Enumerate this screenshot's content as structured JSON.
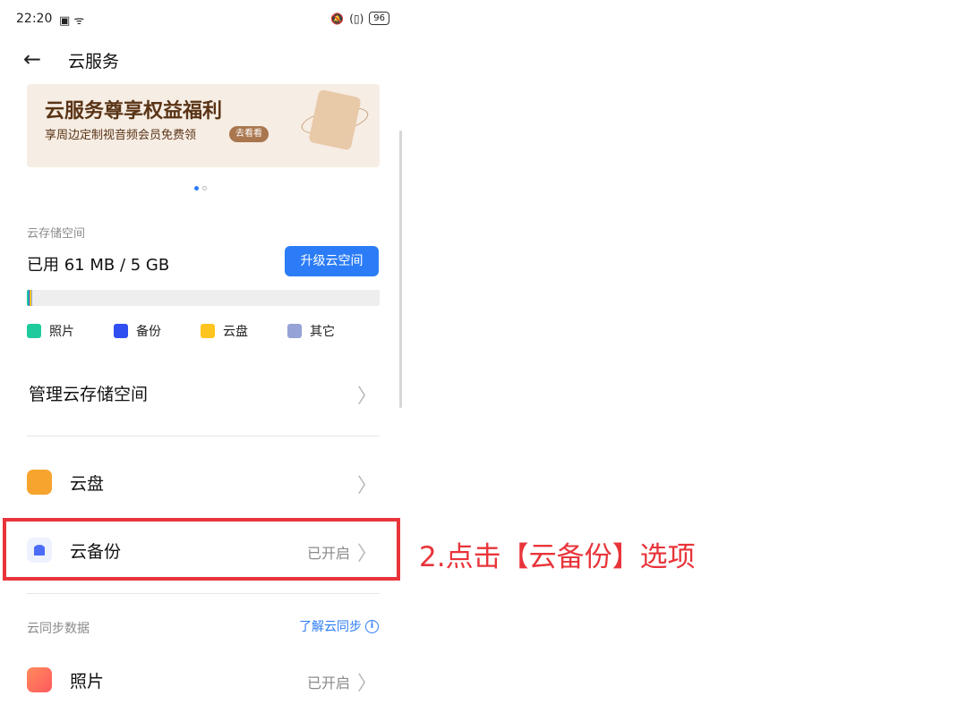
{
  "status_bar": {
    "time": "22:20",
    "battery": "96"
  },
  "nav": {
    "title": "云服务"
  },
  "banner": {
    "title": "云服务尊享权益福利",
    "subtitle": "享周边定制视音频会员免费领",
    "button": "去看看",
    "pages": 2,
    "active_page": 1
  },
  "storage": {
    "section_label": "云存储空间",
    "used_text": "已用 61 MB / 5 GB",
    "upgrade_button": "升级云空间",
    "legend": [
      {
        "label": "照片",
        "color": "#1fcb9c"
      },
      {
        "label": "备份",
        "color": "#2f4ff0"
      },
      {
        "label": "云盘",
        "color": "#ffc41f"
      },
      {
        "label": "其它",
        "color": "#95a3d6"
      }
    ],
    "usage_fraction": 0.012
  },
  "manage_row": {
    "label": "管理云存储空间"
  },
  "cloud_drive_row": {
    "label": "云盘",
    "icon_color": "#f7a42e"
  },
  "backup_row": {
    "label": "云备份",
    "status": "已开启",
    "icon_color": "#4a6cf7"
  },
  "sync_section": {
    "label": "云同步数据",
    "link": "了解云同步"
  },
  "photos_row": {
    "label": "照片",
    "status": "已开启",
    "icon_color": "#ff5a5f"
  },
  "annotation": {
    "text": "2.点击【云备份】选项",
    "color": "#e8343a"
  }
}
